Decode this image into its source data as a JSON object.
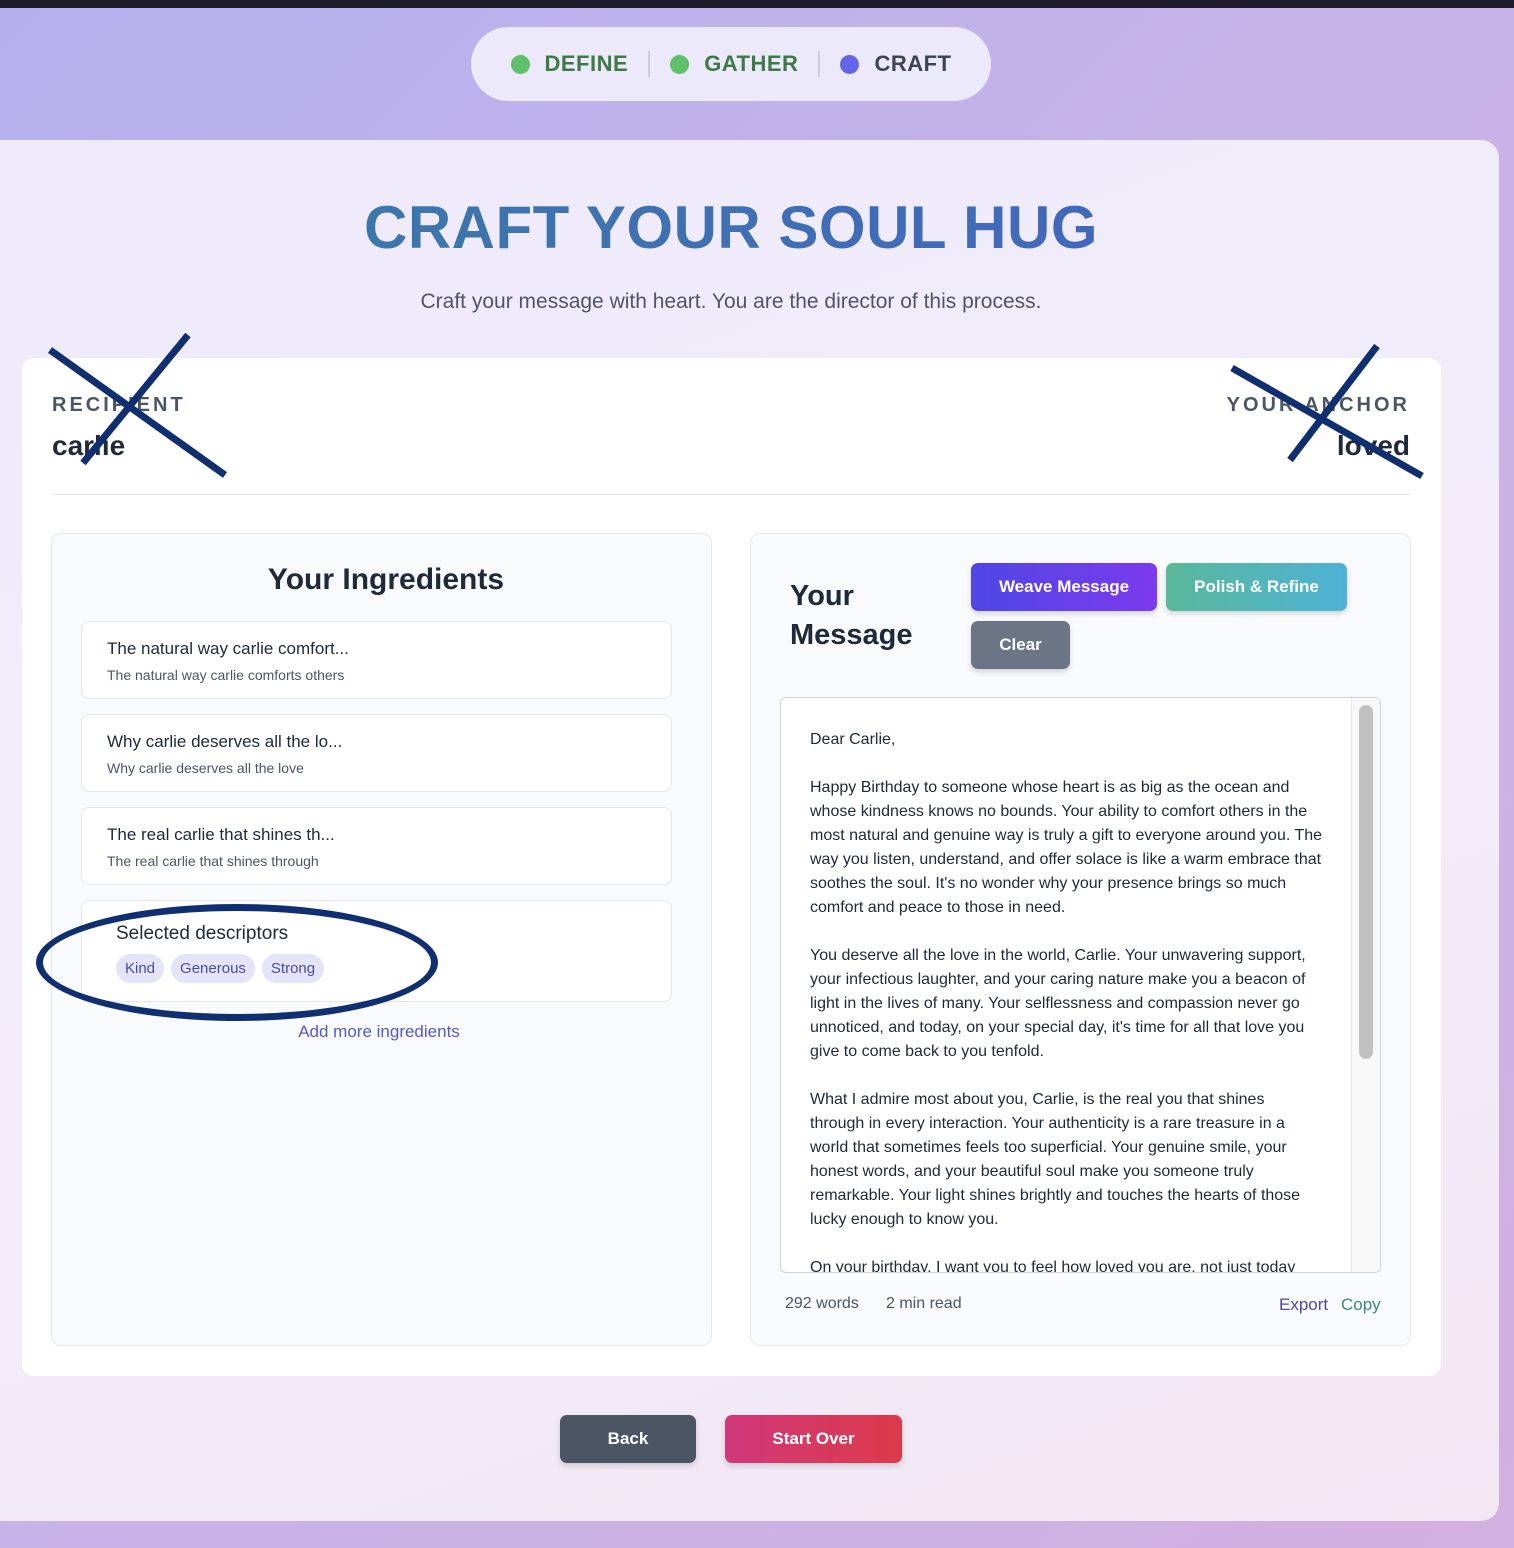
{
  "stepper": {
    "steps": [
      {
        "label": "DEFINE",
        "state": "done"
      },
      {
        "label": "GATHER",
        "state": "done"
      },
      {
        "label": "CRAFT",
        "state": "active"
      }
    ]
  },
  "header": {
    "title": "CRAFT YOUR SOUL HUG",
    "subtitle": "Craft your message with heart. You are the director of this process."
  },
  "recipient": {
    "label": "RECIPIENT",
    "value": "carlie"
  },
  "anchor": {
    "label": "YOUR ANCHOR",
    "value": "loved"
  },
  "ingredients": {
    "title": "Your Ingredients",
    "items": [
      {
        "head": "The natural way carlie comfort...",
        "sub": "The natural way carlie comforts others"
      },
      {
        "head": "Why carlie deserves all the lo...",
        "sub": "Why carlie deserves all the love"
      },
      {
        "head": "The real carlie that shines th...",
        "sub": "The real carlie that shines through"
      }
    ],
    "descriptors_title": "Selected descriptors",
    "descriptors": [
      "Kind",
      "Generous",
      "Strong"
    ],
    "add_more": "Add more ingredients"
  },
  "message": {
    "title": "Your Message",
    "weave_label": "Weave Message",
    "polish_label": "Polish & Refine",
    "clear_label": "Clear",
    "paragraphs": [
      "Dear Carlie,",
      "Happy Birthday to someone whose heart is as big as the ocean and whose kindness knows no bounds. Your ability to comfort others in the most natural and genuine way is truly a gift to everyone around you. The way you listen, understand, and offer solace is like a warm embrace that soothes the soul. It's no wonder why your presence brings so much comfort and peace to those in need.",
      "You deserve all the love in the world, Carlie. Your unwavering support, your infectious laughter, and your caring nature make you a beacon of light in the lives of many. Your selflessness and compassion never go unnoticed, and today, on your special day, it's time for all that love you give to come back to you tenfold.",
      "What I admire most about you, Carlie, is the real you that shines through in every interaction. Your authenticity is a rare treasure in a world that sometimes feels too superficial. Your genuine smile, your honest words, and your beautiful soul make you someone truly remarkable. Your light shines brightly and touches the hearts of those lucky enough to know you.",
      "On your birthday, I want you to feel how loved you are, not just today"
    ],
    "word_count": "292 words",
    "read_time": "2 min read",
    "export_label": "Export",
    "copy_label": "Copy"
  },
  "footer": {
    "back_label": "Back",
    "start_over_label": "Start Over"
  },
  "colors": {
    "done": "#5fbf6a",
    "active": "#6466e6",
    "annotation": "#102f70"
  }
}
